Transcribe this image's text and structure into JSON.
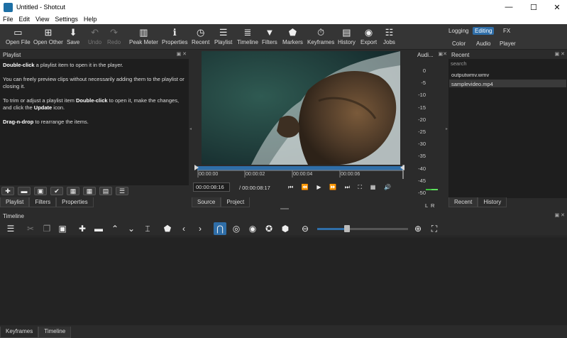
{
  "window": {
    "title": "Untitled - Shotcut",
    "minimize": "—",
    "maximize": "☐",
    "close": "✕"
  },
  "menu": [
    "File",
    "Edit",
    "View",
    "Settings",
    "Help"
  ],
  "toolbar": [
    {
      "label": "Open File",
      "icon": "folder-icon",
      "glyph": "▭"
    },
    {
      "label": "Open Other",
      "icon": "open-other-icon",
      "glyph": "⊞"
    },
    {
      "label": "Save",
      "icon": "save-icon",
      "glyph": "⬇"
    },
    {
      "label": "Undo",
      "icon": "undo-icon",
      "glyph": "↶",
      "disabled": true
    },
    {
      "label": "Redo",
      "icon": "redo-icon",
      "glyph": "↷",
      "disabled": true
    },
    {
      "label": "Peak Meter",
      "icon": "peak-meter-icon",
      "glyph": "▥"
    },
    {
      "label": "Properties",
      "icon": "info-icon",
      "glyph": "ℹ"
    },
    {
      "label": "Recent",
      "icon": "clock-icon",
      "glyph": "◷"
    },
    {
      "label": "Playlist",
      "icon": "list-icon",
      "glyph": "☰"
    },
    {
      "label": "Timeline",
      "icon": "timeline-icon",
      "glyph": "≣"
    },
    {
      "label": "Filters",
      "icon": "filter-icon",
      "glyph": "▼"
    },
    {
      "label": "Markers",
      "icon": "marker-icon",
      "glyph": "⬟"
    },
    {
      "label": "Keyframes",
      "icon": "stopwatch-icon",
      "glyph": "⏱"
    },
    {
      "label": "History",
      "icon": "history-icon",
      "glyph": "▤"
    },
    {
      "label": "Export",
      "icon": "export-icon",
      "glyph": "◉"
    },
    {
      "label": "Jobs",
      "icon": "jobs-icon",
      "glyph": "☷"
    }
  ],
  "layouts": {
    "top": [
      "Logging",
      "Editing",
      "FX"
    ],
    "bottom": [
      "Color",
      "Audio",
      "Player"
    ],
    "active": "Editing"
  },
  "playlist": {
    "title": "Playlist",
    "p1_b": "Double-click",
    "p1": " a playlist item to open it in the player.",
    "p2": "You can freely preview clips without necessarily adding them to the playlist or closing it.",
    "p3a": "To trim or adjust a playlist item ",
    "p3_b": "Double-click",
    "p3b": " to open it, make the changes, and click the ",
    "p3_c": "Update",
    "p3c": " icon.",
    "p4_b": "Drag-n-drop",
    "p4": " to rearrange the items.",
    "tabs": [
      "Playlist",
      "Filters",
      "Properties"
    ]
  },
  "player": {
    "ticks": [
      "00:00:00",
      "00:00:02",
      "00:00:04",
      "00:00:06"
    ],
    "position": "00:00:08:16",
    "duration": "/ 00:00:08:17",
    "tabs": [
      "Source",
      "Project"
    ]
  },
  "audio": {
    "title": "Audi...",
    "scale": [
      "0",
      "-5",
      "-10",
      "-15",
      "-20",
      "-25",
      "-30",
      "-35",
      "-40",
      "-45",
      "-50"
    ],
    "lr": "L  R"
  },
  "recent": {
    "title": "Recent",
    "search": "search",
    "items": [
      "outputwmv.wmv",
      "samplevideo.mp4"
    ],
    "tabs": [
      "Recent",
      "History"
    ]
  },
  "timeline": {
    "title": "Timeline",
    "bottom_tabs": [
      "Keyframes",
      "Timeline"
    ]
  }
}
